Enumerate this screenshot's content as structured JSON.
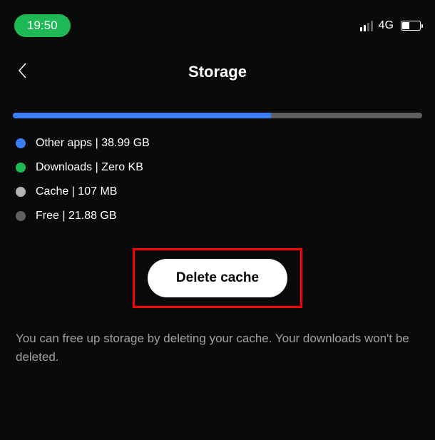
{
  "status_bar": {
    "time": "19:50",
    "network": "4G"
  },
  "header": {
    "title": "Storage"
  },
  "storage": {
    "progress_percent": 63,
    "items": [
      {
        "label": "Other apps | 38.99 GB",
        "color": "#3a7df5"
      },
      {
        "label": "Downloads | Zero KB",
        "color": "#1db954"
      },
      {
        "label": "Cache | 107 MB",
        "color": "#b3b3b3"
      },
      {
        "label": "Free | 21.88 GB",
        "color": "#606060"
      }
    ]
  },
  "actions": {
    "delete_cache_label": "Delete cache"
  },
  "description": {
    "text": "You can free up storage by deleting your cache. Your downloads won't be deleted."
  },
  "annotation": {
    "highlight_color": "#ff0000"
  }
}
